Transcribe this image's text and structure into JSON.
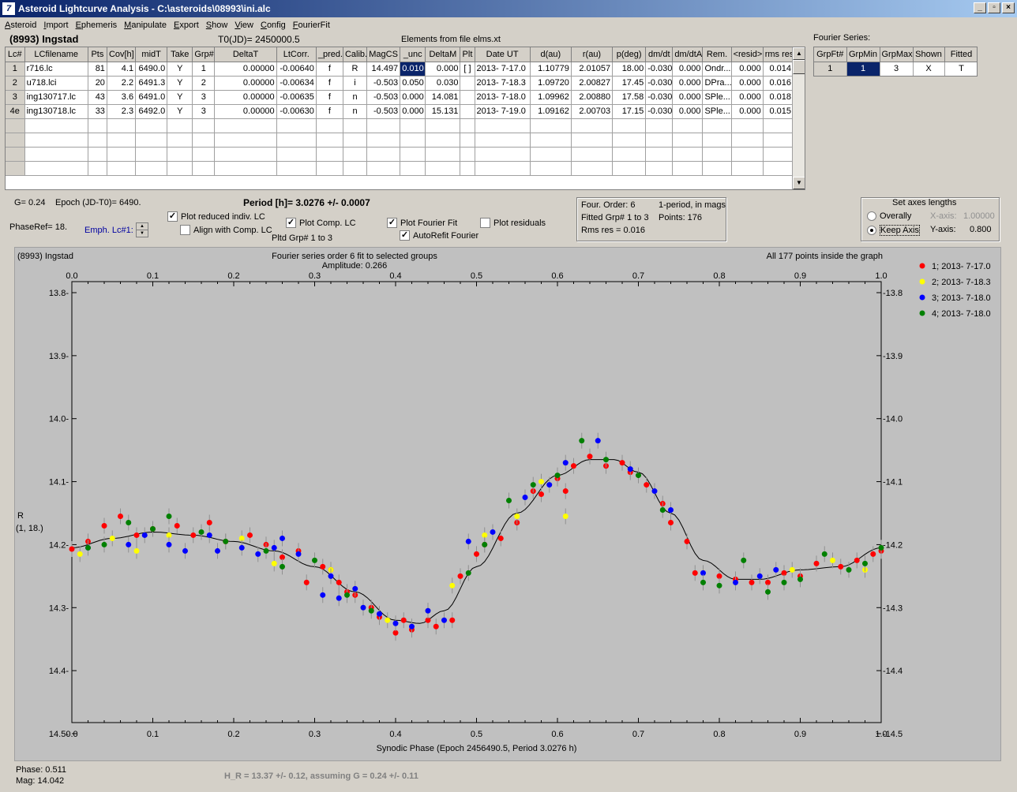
{
  "window": {
    "title": "Asteroid Lightcurve Analysis - C:\\asteroids\\08993\\ini.alc",
    "icon": "app-icon"
  },
  "menu": [
    "Asteroid",
    "Import",
    "Ephemeris",
    "Manipulate",
    "Export",
    "Show",
    "View",
    "Config",
    "FourierFit"
  ],
  "header": {
    "asteroid": "(8993) Ingstad",
    "t0": "T0(JD)= 2450000.5",
    "elements": "Elements from file elms.xt"
  },
  "lc_table": {
    "columns": [
      "Lc#",
      "LCfilename",
      "Pts",
      "Cov[h]",
      "midT",
      "Take",
      "Grp#",
      "DeltaT",
      "LtCorr.",
      "_pred.",
      "Calib.",
      "MagCS",
      "_unc",
      "DeltaM",
      "Plt",
      "Date UT",
      "d(au)",
      "r(au)",
      "p(deg)",
      "dm/dt",
      "dm/dtA",
      "Rem.",
      "<resid>",
      "rms res"
    ],
    "rows": [
      [
        "1",
        "r716.lc",
        "81",
        "4.1",
        "6490.0",
        "Y",
        "1",
        "0.00000",
        "-0.00640",
        "f",
        "R",
        "14.497",
        "0.010",
        "0.000",
        "[ ]",
        "2013- 7-17.0",
        "1.10779",
        "2.01057",
        "18.00",
        "-0.030",
        "0.000",
        "Ondr...",
        "0.000",
        "0.014"
      ],
      [
        "2",
        "u718.lci",
        "20",
        "2.2",
        "6491.3",
        "Y",
        "2",
        "0.00000",
        "-0.00634",
        "f",
        "i",
        "-0.503",
        "0.050",
        "0.030",
        "",
        "2013- 7-18.3",
        "1.09720",
        "2.00827",
        "17.45",
        "-0.030",
        "0.000",
        "DPra...",
        "0.000",
        "0.016"
      ],
      [
        "3",
        "ing130717.lc",
        "43",
        "3.6",
        "6491.0",
        "Y",
        "3",
        "0.00000",
        "-0.00635",
        "f",
        "n",
        "-0.503",
        "0.000",
        "14.081",
        "",
        "2013- 7-18.0",
        "1.09962",
        "2.00880",
        "17.58",
        "-0.030",
        "0.000",
        "SPle...",
        "0.000",
        "0.018"
      ],
      [
        "4e",
        "ing130718.lc",
        "33",
        "2.3",
        "6492.0",
        "Y",
        "3",
        "0.00000",
        "-0.00630",
        "f",
        "n",
        "-0.503",
        "0.000",
        "15.131",
        "",
        "2013- 7-19.0",
        "1.09162",
        "2.00703",
        "17.15",
        "-0.030",
        "0.000",
        "SPle...",
        "0.000",
        "0.015"
      ]
    ]
  },
  "fourier_series": {
    "label": "Fourier Series:",
    "columns": [
      "GrpFt#",
      "GrpMin",
      "GrpMax",
      "Shown",
      "Fitted"
    ],
    "row": [
      "1",
      "1",
      "3",
      "X",
      "T"
    ]
  },
  "controls": {
    "g": "G= 0.24",
    "epoch": "Epoch (JD-T0)= 6490.",
    "period": "Period [h]= 3.0276 +/- 0.0007",
    "phaseref": "PhaseRef= 18.",
    "emph": "Emph. Lc#1:",
    "plot_reduced": "Plot reduced indiv. LC",
    "align_comp": "Align with Comp. LC",
    "plot_comp": "Plot Comp. LC",
    "pltd_grp": "Pltd Grp#  1   to   3",
    "plot_fourier": "Plot Fourier Fit",
    "autorefit": "AutoRefit Fourier",
    "plot_residuals": "Plot residuals",
    "info": [
      "Four. Order:  6",
      "1-period, in mags",
      "Fitted Grp# 1 to 3",
      "Points: 176",
      "Rms res     = 0.016"
    ],
    "axes": {
      "title": "Set axes lengths",
      "overally": "Overally",
      "keep_axis": "Keep Axis",
      "xaxis_label": "X-axis:",
      "xaxis_val": "1.00000",
      "yaxis_label": "Y-axis:",
      "yaxis_val": "0.800"
    }
  },
  "plot_text": {
    "object": "(8993) Ingstad",
    "fit_title": "Fourier series order 6 fit to selected groups",
    "amplitude": "Amplitude: 0.266",
    "inside": "All 177 points inside the graph",
    "ylabel1": "R",
    "ylabel2": "(1, 18.)",
    "xlabel": "Synodic Phase (Epoch 2456490.5, Period 3.0276 h)"
  },
  "footer": {
    "phase": "Phase:  0.511",
    "mag": "Mag:   14.042",
    "hr": "H_R = 13.37 +/- 0.12, assuming G = 0.24 +/- 0.11"
  },
  "chart_data": {
    "type": "scatter",
    "xlim": [
      0,
      1
    ],
    "ylim": [
      14.5,
      13.8
    ],
    "x_ticks": [
      0.0,
      0.1,
      0.2,
      0.3,
      0.4,
      0.5,
      0.6,
      0.7,
      0.8,
      0.9,
      1.0
    ],
    "y_ticks": [
      13.8,
      13.9,
      14.0,
      14.1,
      14.2,
      14.3,
      14.4,
      14.5
    ],
    "legend_placement": "right",
    "series": [
      {
        "name": "1; 2013- 7-17.0",
        "color": "#ff0000",
        "points": [
          [
            0.0,
            14.207
          ],
          [
            0.02,
            14.195
          ],
          [
            0.04,
            14.17
          ],
          [
            0.06,
            14.155
          ],
          [
            0.08,
            14.185
          ],
          [
            0.1,
            14.175
          ],
          [
            0.13,
            14.17
          ],
          [
            0.15,
            14.185
          ],
          [
            0.17,
            14.165
          ],
          [
            0.19,
            14.195
          ],
          [
            0.22,
            14.185
          ],
          [
            0.24,
            14.2
          ],
          [
            0.26,
            14.22
          ],
          [
            0.28,
            14.21
          ],
          [
            0.29,
            14.26
          ],
          [
            0.31,
            14.235
          ],
          [
            0.32,
            14.24
          ],
          [
            0.33,
            14.26
          ],
          [
            0.34,
            14.275
          ],
          [
            0.35,
            14.28
          ],
          [
            0.37,
            14.3
          ],
          [
            0.38,
            14.315
          ],
          [
            0.4,
            14.34
          ],
          [
            0.41,
            14.32
          ],
          [
            0.42,
            14.335
          ],
          [
            0.44,
            14.32
          ],
          [
            0.45,
            14.33
          ],
          [
            0.47,
            14.32
          ],
          [
            0.48,
            14.25
          ],
          [
            0.5,
            14.215
          ],
          [
            0.51,
            14.2
          ],
          [
            0.53,
            14.19
          ],
          [
            0.55,
            14.165
          ],
          [
            0.57,
            14.115
          ],
          [
            0.58,
            14.12
          ],
          [
            0.6,
            14.095
          ],
          [
            0.61,
            14.115
          ],
          [
            0.62,
            14.075
          ],
          [
            0.64,
            14.06
          ],
          [
            0.66,
            14.075
          ],
          [
            0.68,
            14.07
          ],
          [
            0.69,
            14.085
          ],
          [
            0.71,
            14.105
          ],
          [
            0.73,
            14.135
          ],
          [
            0.74,
            14.165
          ],
          [
            0.76,
            14.195
          ],
          [
            0.77,
            14.245
          ],
          [
            0.8,
            14.25
          ],
          [
            0.82,
            14.255
          ],
          [
            0.84,
            14.26
          ],
          [
            0.86,
            14.26
          ],
          [
            0.88,
            14.245
          ],
          [
            0.9,
            14.25
          ],
          [
            0.92,
            14.23
          ],
          [
            0.95,
            14.235
          ],
          [
            0.97,
            14.225
          ],
          [
            0.99,
            14.215
          ],
          [
            1.0,
            14.21
          ]
        ]
      },
      {
        "name": "2; 2013- 7-18.3",
        "color": "#ffff00",
        "points": [
          [
            0.01,
            14.215
          ],
          [
            0.05,
            14.19
          ],
          [
            0.08,
            14.21
          ],
          [
            0.12,
            14.185
          ],
          [
            0.21,
            14.19
          ],
          [
            0.25,
            14.23
          ],
          [
            0.32,
            14.24
          ],
          [
            0.36,
            14.3
          ],
          [
            0.39,
            14.32
          ],
          [
            0.44,
            14.305
          ],
          [
            0.47,
            14.265
          ],
          [
            0.51,
            14.185
          ],
          [
            0.55,
            14.155
          ],
          [
            0.58,
            14.1
          ],
          [
            0.61,
            14.155
          ],
          [
            0.89,
            14.24
          ],
          [
            0.94,
            14.225
          ],
          [
            0.98,
            14.24
          ]
        ]
      },
      {
        "name": "3; 2013- 7-18.0",
        "color": "#0000ff",
        "points": [
          [
            0.02,
            14.205
          ],
          [
            0.07,
            14.2
          ],
          [
            0.09,
            14.185
          ],
          [
            0.12,
            14.2
          ],
          [
            0.14,
            14.21
          ],
          [
            0.17,
            14.185
          ],
          [
            0.18,
            14.21
          ],
          [
            0.21,
            14.205
          ],
          [
            0.23,
            14.215
          ],
          [
            0.25,
            14.205
          ],
          [
            0.26,
            14.19
          ],
          [
            0.28,
            14.215
          ],
          [
            0.31,
            14.28
          ],
          [
            0.32,
            14.25
          ],
          [
            0.33,
            14.285
          ],
          [
            0.35,
            14.27
          ],
          [
            0.36,
            14.3
          ],
          [
            0.38,
            14.31
          ],
          [
            0.4,
            14.325
          ],
          [
            0.42,
            14.33
          ],
          [
            0.44,
            14.305
          ],
          [
            0.46,
            14.32
          ],
          [
            0.49,
            14.195
          ],
          [
            0.52,
            14.18
          ],
          [
            0.56,
            14.125
          ],
          [
            0.59,
            14.105
          ],
          [
            0.61,
            14.07
          ],
          [
            0.65,
            14.035
          ],
          [
            0.69,
            14.08
          ],
          [
            0.72,
            14.115
          ],
          [
            0.74,
            14.145
          ],
          [
            0.78,
            14.245
          ],
          [
            0.82,
            14.26
          ],
          [
            0.85,
            14.25
          ],
          [
            0.87,
            14.24
          ]
        ]
      },
      {
        "name": "4; 2013- 7-18.0",
        "color": "#008000",
        "points": [
          [
            0.02,
            14.205
          ],
          [
            0.04,
            14.2
          ],
          [
            0.07,
            14.165
          ],
          [
            0.1,
            14.175
          ],
          [
            0.12,
            14.155
          ],
          [
            0.16,
            14.18
          ],
          [
            0.19,
            14.195
          ],
          [
            0.24,
            14.21
          ],
          [
            0.26,
            14.235
          ],
          [
            0.3,
            14.225
          ],
          [
            0.34,
            14.28
          ],
          [
            0.37,
            14.305
          ],
          [
            0.49,
            14.245
          ],
          [
            0.51,
            14.2
          ],
          [
            0.54,
            14.13
          ],
          [
            0.57,
            14.105
          ],
          [
            0.6,
            14.09
          ],
          [
            0.63,
            14.035
          ],
          [
            0.66,
            14.065
          ],
          [
            0.7,
            14.09
          ],
          [
            0.73,
            14.145
          ],
          [
            0.78,
            14.26
          ],
          [
            0.8,
            14.265
          ],
          [
            0.83,
            14.225
          ],
          [
            0.86,
            14.275
          ],
          [
            0.88,
            14.26
          ],
          [
            0.9,
            14.255
          ],
          [
            0.93,
            14.215
          ],
          [
            0.96,
            14.24
          ],
          [
            0.98,
            14.23
          ],
          [
            1.0,
            14.205
          ]
        ]
      }
    ]
  }
}
